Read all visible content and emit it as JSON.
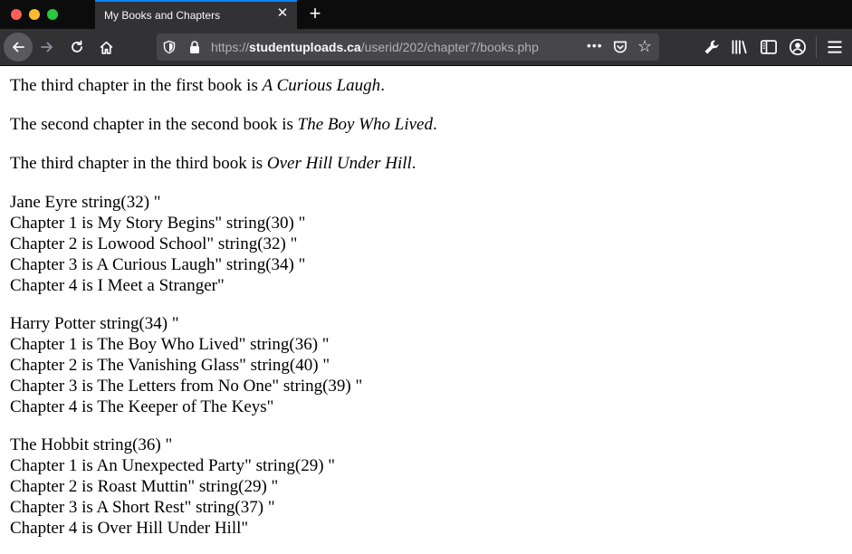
{
  "tab": {
    "title": "My Books and Chapters"
  },
  "urlbar": {
    "scheme": "https://",
    "host": "studentuploads.ca",
    "path": "/userid/202/chapter7/books.php"
  },
  "icons": {
    "back": "back-arrow-icon",
    "forward": "forward-arrow-icon",
    "reload": "reload-icon",
    "home": "home-icon",
    "tracking": "shield-icon",
    "lock": "lock-icon",
    "more": "more-dots-icon",
    "pocket": "pocket-icon",
    "bookmark": "star-icon",
    "tools": "wrench-icon",
    "library": "library-icon",
    "sidebar": "sidebar-icon",
    "account": "account-icon",
    "menu": "hamburger-menu-icon",
    "newtab": "plus-icon",
    "close": "close-icon"
  },
  "colors": {
    "tab_accent": "#0a84ff",
    "chrome_dark": "#0c0c0d",
    "chrome": "#323234",
    "urlbar": "#474749"
  },
  "sentences": [
    {
      "prefix": "The third chapter in the first book is ",
      "title": "A Curious Laugh",
      "suffix": "."
    },
    {
      "prefix": "The second chapter in the second book is ",
      "title": "The Boy Who Lived",
      "suffix": "."
    },
    {
      "prefix": "The third chapter in the third book is ",
      "title": "Over Hill Under Hill",
      "suffix": "."
    }
  ],
  "books": [
    {
      "lines": [
        "Jane Eyre string(32) \"",
        "Chapter 1 is My Story Begins\" string(30) \"",
        "Chapter 2 is Lowood School\" string(32) \"",
        "Chapter 3 is A Curious Laugh\" string(34) \"",
        "Chapter 4 is I Meet a Stranger\""
      ]
    },
    {
      "lines": [
        "Harry Potter string(34) \"",
        "Chapter 1 is The Boy Who Lived\" string(36) \"",
        "Chapter 2 is The Vanishing Glass\" string(40) \"",
        "Chapter 3 is The Letters from No One\" string(39) \"",
        "Chapter 4 is The Keeper of The Keys\""
      ]
    },
    {
      "lines": [
        "The Hobbit string(36) \"",
        "Chapter 1 is An Unexpected Party\" string(29) \"",
        "Chapter 2 is Roast Muttin\" string(29) \"",
        "Chapter 3 is A Short Rest\" string(37) \"",
        "Chapter 4 is Over Hill Under Hill\""
      ]
    }
  ]
}
